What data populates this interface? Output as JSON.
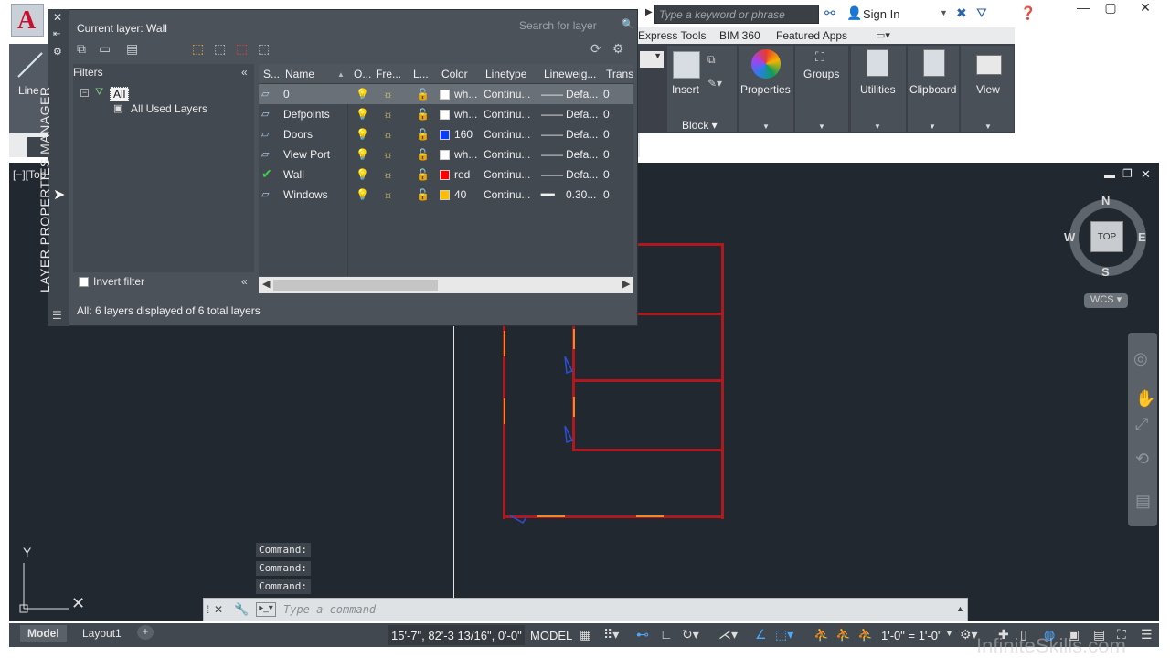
{
  "titlebar": {
    "search_placeholder": "Type a keyword or phrase",
    "sign_in": "Sign In"
  },
  "ribbon": {
    "tabs": [
      "Express Tools",
      "BIM 360",
      "Featured Apps"
    ],
    "line_label": "Line",
    "panels": {
      "insert": "Insert",
      "block": "Block",
      "properties": "Properties",
      "groups": "Groups",
      "utilities": "Utilities",
      "clipboard": "Clipboard",
      "view": "View"
    }
  },
  "viewport_label": "[−][Top",
  "layer_manager": {
    "vertical_title": "LAYER PROPERTIES MANAGER",
    "current_layer": "Current layer: Wall",
    "search_placeholder": "Search for layer",
    "filters_header": "Filters",
    "filter_all": "All",
    "filter_used": "All Used Layers",
    "invert_filter": "Invert filter",
    "status": "All: 6 layers displayed of 6 total layers",
    "columns": [
      "S...",
      "Name",
      "O...",
      "Fre...",
      "L...",
      "Color",
      "Linetype",
      "Lineweig...",
      "Trans"
    ],
    "layers": [
      {
        "name": "0",
        "color_name": "wh...",
        "color": "#ffffff",
        "linetype": "Continu...",
        "lineweight": "Defa...",
        "trans": "0",
        "current": false,
        "selected": true
      },
      {
        "name": "Defpoints",
        "color_name": "wh...",
        "color": "#ffffff",
        "linetype": "Continu...",
        "lineweight": "Defa...",
        "trans": "0",
        "current": false,
        "selected": false
      },
      {
        "name": "Doors",
        "color_name": "160",
        "color": "#0a3cff",
        "linetype": "Continu...",
        "lineweight": "Defa...",
        "trans": "0",
        "current": false,
        "selected": false
      },
      {
        "name": "View Port",
        "color_name": "wh...",
        "color": "#ffffff",
        "linetype": "Continu...",
        "lineweight": "Defa...",
        "trans": "0",
        "current": false,
        "selected": false
      },
      {
        "name": "Wall",
        "color_name": "red",
        "color": "#ff0000",
        "linetype": "Continu...",
        "lineweight": "Defa...",
        "trans": "0",
        "current": true,
        "selected": false
      },
      {
        "name": "Windows",
        "color_name": "40",
        "color": "#ffbf00",
        "linetype": "Continu...",
        "lineweight": "0.30...",
        "trans": "0",
        "current": false,
        "selected": false
      }
    ]
  },
  "viewcube": {
    "n": "N",
    "s": "S",
    "e": "E",
    "w": "W",
    "top": "TOP",
    "wcs": "WCS"
  },
  "command": {
    "history": [
      "Command:",
      "Command:",
      "Command:"
    ],
    "placeholder": "Type a command"
  },
  "statusbar": {
    "tab_model": "Model",
    "tab_layout": "Layout1",
    "coords": "15'-7\", 82'-3 13/16\", 0'-0\"",
    "model": "MODEL",
    "scale": "1'-0\" = 1'-0\""
  },
  "watermark": "InfiniteSkills.com",
  "colors": {
    "wall": "#b01820",
    "door_opening": "#f08a24",
    "drawing_bg": "#212830",
    "panel_bg": "#4b525a"
  }
}
